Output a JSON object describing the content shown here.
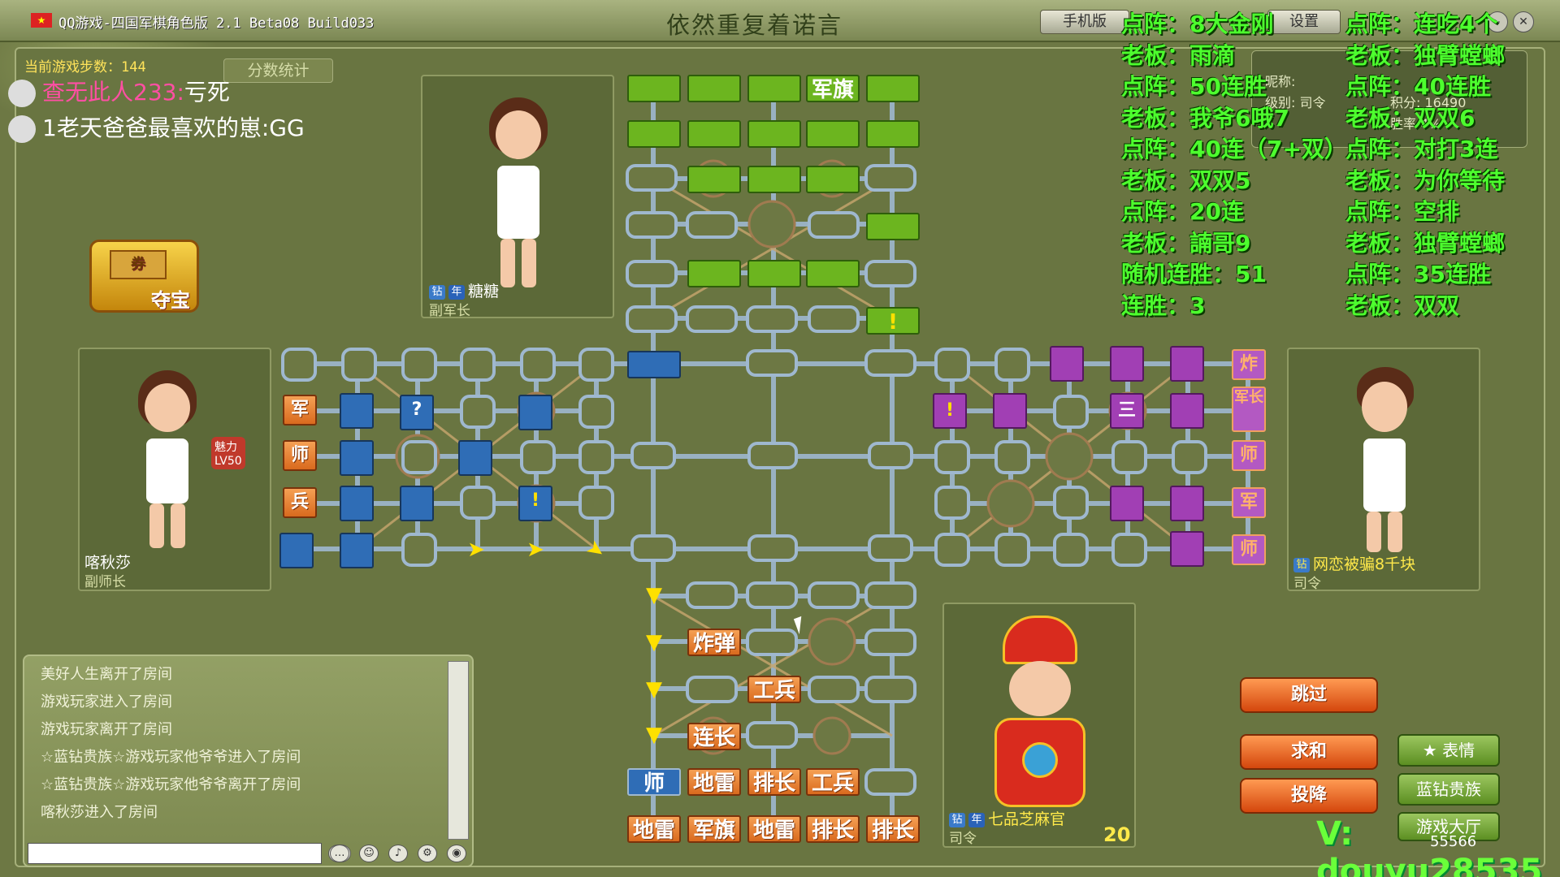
{
  "window": {
    "app_title": "QQ游戏-四国军棋角色版 2.1 Beta08 Build033",
    "game_name": "依然重复着诺言",
    "mobile_btn": "手机版",
    "settings_btn": "设置"
  },
  "header": {
    "step_count": "当前游戏步数：144",
    "score_btn": "分数统计"
  },
  "spectators": [
    {
      "name": "查无此人233:",
      "msg": "亏死"
    },
    {
      "name": "1老天爸爸最喜欢的崽:",
      "msg": "GG"
    }
  ],
  "treasure": {
    "ticket": "券",
    "label": "夺宝"
  },
  "players": {
    "top": {
      "name": "糖糖",
      "rank": "副军长"
    },
    "left": {
      "name": "喀秋莎",
      "rank": "副师长",
      "charm": "魅力",
      "level": "LV50"
    },
    "right": {
      "name": "网恋被骗8千块",
      "rank": "司令"
    },
    "bottom": {
      "name": "七品芝麻官",
      "rank": "司令",
      "count": "20"
    }
  },
  "board": {
    "top_flag": "军旗",
    "top_mark": "!",
    "left_pieces": [
      "军",
      "师",
      "兵"
    ],
    "left_marks": [
      "?",
      "!"
    ],
    "right_pieces": [
      "炸",
      "军长",
      "师",
      "军",
      "师"
    ],
    "right_marks": [
      "!",
      "三"
    ],
    "bottom_rows": [
      [
        "炸弹"
      ],
      [
        "工兵"
      ],
      [
        "连长"
      ],
      [
        "师",
        "地雷",
        "排长",
        "工兵"
      ],
      [
        "地雷",
        "军旗",
        "地雷",
        "排长",
        "排长"
      ]
    ]
  },
  "overlay": {
    "col1": [
      "点阵：8大金刚",
      "老板：雨滴",
      "点阵：50连胜",
      "老板：我爷6哦7",
      "点阵：40连（7+双）",
      "老板：双双5",
      "点阵：20连",
      "老板：諵哥9",
      "随机连胜：51",
      "连胜：3"
    ],
    "col2": [
      "点阵：连吃4个",
      "老板：独臂螳螂",
      "点阵：40连胜",
      "老板：双双6",
      "点阵：对打3连",
      "老板：为你等待",
      "点阵：空排",
      "老板：独臂螳螂",
      "点阵：35连胜",
      "老板：双双"
    ],
    "watermark": "V: douyu28535"
  },
  "info_panel": {
    "nick_label": "昵称:",
    "level_label": "级别: 司令",
    "score_label": "积分: 16490",
    "win_label": "胜率 4%",
    "extra": "55566"
  },
  "chat": {
    "lines": [
      "美好人生离开了房间",
      "游戏玩家进入了房间",
      "游戏玩家离开了房间",
      "☆蓝钻贵族☆游戏玩家他爷爷进入了房间",
      "☆蓝钻贵族☆游戏玩家他爷爷离开了房间",
      "喀秋莎进入了房间"
    ],
    "input_placeholder": ""
  },
  "actions": {
    "skip": "跳过",
    "draw": "求和",
    "surrender": "投降",
    "emote": "表情",
    "bluediamond": "蓝钻贵族",
    "gameroom": "游戏大厅"
  }
}
